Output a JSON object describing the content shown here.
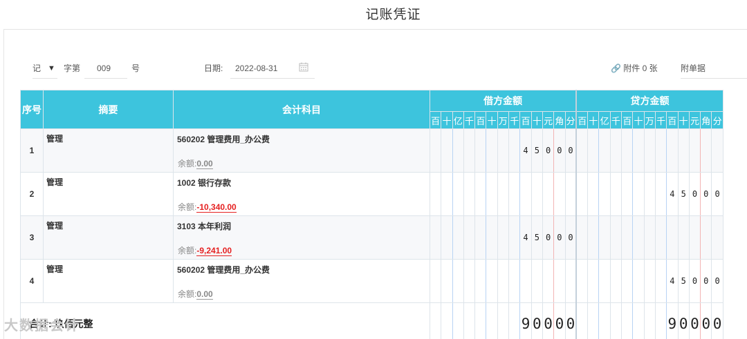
{
  "title": "记账凭证",
  "header": {
    "word_value": "记",
    "word_label": "字第",
    "number": "009",
    "number_suffix": "号",
    "date_label": "日期:",
    "date_value": "2022-08-31",
    "attachment_text": "附件 0 张",
    "attach_doc_label": "附单据"
  },
  "columns": {
    "seq": "序号",
    "summary": "摘要",
    "account": "会计科目",
    "debit": "借方金额",
    "credit": "贷方金额",
    "units": [
      "百",
      "十",
      "亿",
      "千",
      "百",
      "十",
      "万",
      "千",
      "百",
      "十",
      "元",
      "角",
      "分"
    ]
  },
  "entries": [
    {
      "no": "1",
      "summary": "管理",
      "account": "560202 管理费用_办公费",
      "balance_label": "余额:",
      "balance": "0.00",
      "debit": "45000",
      "credit": ""
    },
    {
      "no": "2",
      "summary": "管理",
      "account": "1002 银行存款",
      "balance_label": "余额:",
      "balance": "-10,340.00",
      "debit": "",
      "credit": "45000"
    },
    {
      "no": "3",
      "summary": "管理",
      "account": "3103 本年利润",
      "balance_label": "余额:",
      "balance": "-9,241.00",
      "debit": "45000",
      "credit": ""
    },
    {
      "no": "4",
      "summary": "管理",
      "account": "560202 管理费用_办公费",
      "balance_label": "余额:",
      "balance": "0.00",
      "debit": "",
      "credit": "45000"
    }
  ],
  "total": {
    "label": "合计: 玖佰元整",
    "debit": "90000",
    "credit": "90000"
  },
  "watermark": "大数据会计",
  "colors": {
    "header_bg": "#3dc4dd",
    "negative": "#e52020"
  }
}
